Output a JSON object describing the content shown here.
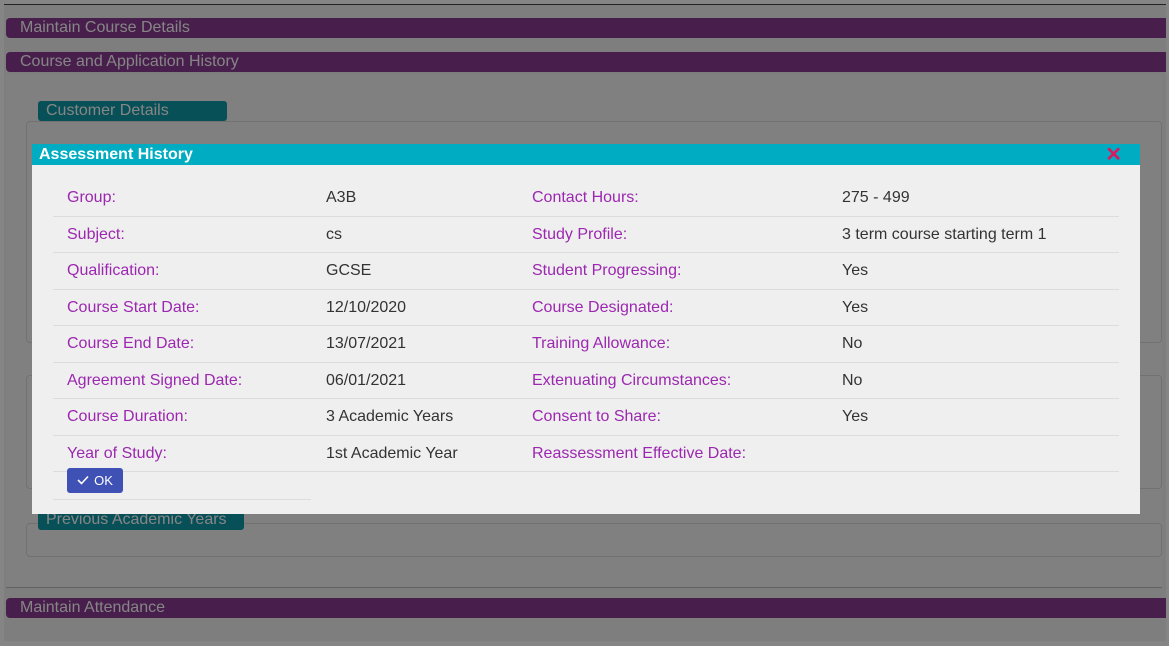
{
  "background": {
    "sections": [
      "Maintain Course Details",
      "Course and Application History",
      "Maintain Attendance"
    ],
    "customer_details_tab": "Customer Details",
    "previous_years_tab": "Previous Academic Years"
  },
  "modal": {
    "title": "Assessment History",
    "close_icon": "close-icon",
    "rows": [
      {
        "label1": "Group:",
        "value1": "A3B",
        "label2": "Contact Hours:",
        "value2": "275 - 499"
      },
      {
        "label1": "Subject:",
        "value1": "cs",
        "label2": "Study Profile:",
        "value2": "3 term course starting term 1"
      },
      {
        "label1": "Qualification:",
        "value1": "GCSE",
        "label2": "Student Progressing:",
        "value2": "Yes"
      },
      {
        "label1": "Course Start Date:",
        "value1": "12/10/2020",
        "label2": "Course Designated:",
        "value2": "Yes"
      },
      {
        "label1": "Course End Date:",
        "value1": "13/07/2021",
        "label2": "Training Allowance:",
        "value2": "No"
      },
      {
        "label1": "Agreement Signed Date:",
        "value1": "06/01/2021",
        "label2": "Extenuating Circumstances:",
        "value2": "No"
      },
      {
        "label1": "Course Duration:",
        "value1": "3 Academic Years",
        "label2": "Consent to Share:",
        "value2": "Yes"
      },
      {
        "label1": "Year of Study:",
        "value1": "1st Academic Year",
        "label2": "Reassessment Effective Date:",
        "value2": ""
      }
    ],
    "ok_label": "OK",
    "ok_icon": "check-icon"
  },
  "colors": {
    "section_bar": "#8a3a92",
    "teal_tab": "#0e9aa8",
    "modal_header": "#00acc1",
    "label": "#9c27b0",
    "close": "#d81b60",
    "button": "#3f51b5"
  }
}
